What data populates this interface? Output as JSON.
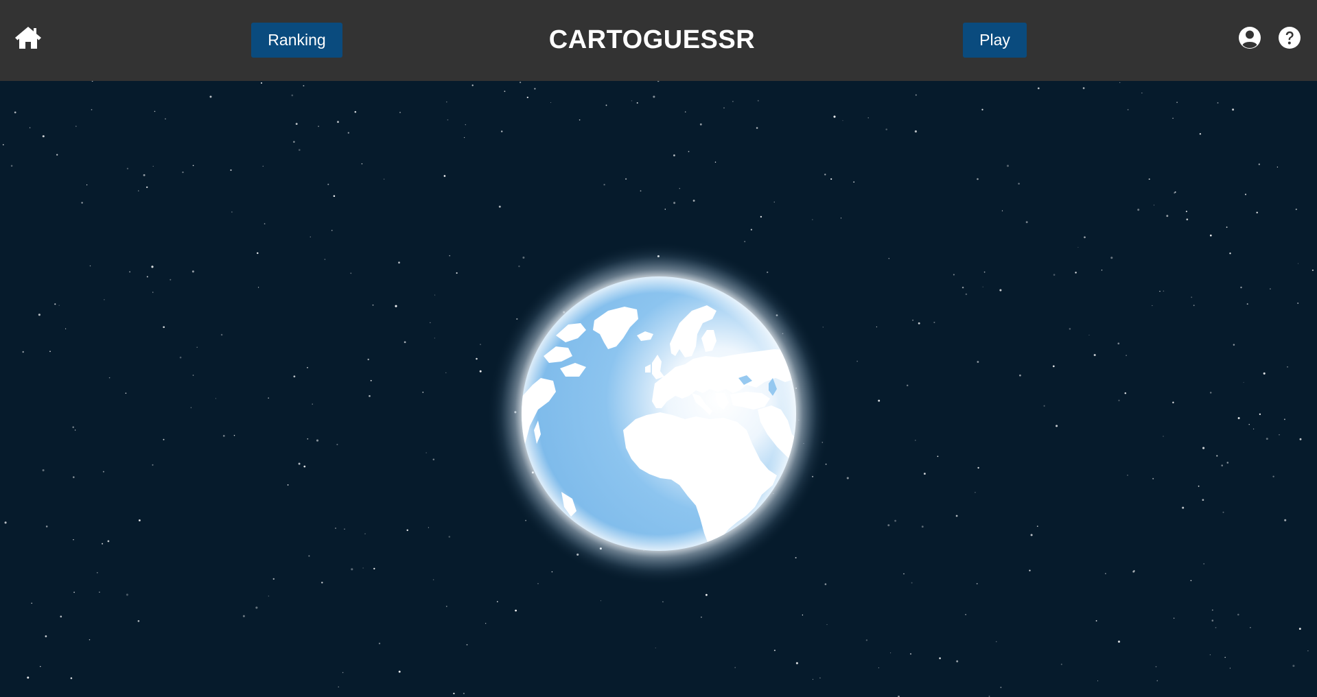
{
  "header": {
    "title": "CARTOGUESSR",
    "ranking_label": "Ranking",
    "play_label": "Play",
    "home_icon": "home-icon",
    "account_icon": "user-circle-icon",
    "help_icon": "question-circle-icon"
  },
  "colors": {
    "header_bg": "#333333",
    "button_bg": "#0a4b7e",
    "space_bg": "#061b2c",
    "ocean": "#7bb9ea",
    "land": "#ffffff"
  }
}
